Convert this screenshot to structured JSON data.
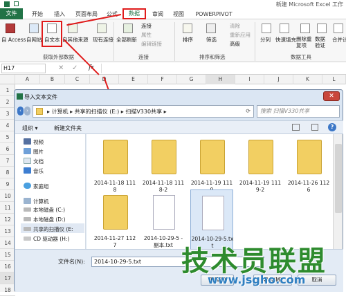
{
  "window": {
    "title": "新建 Microsoft Excel 工作"
  },
  "ribbon_tabs": [
    "文件",
    "开始",
    "插入",
    "页面布局",
    "公式",
    "数据",
    "审阅",
    "视图",
    "POWERPIVOT"
  ],
  "ribbon": {
    "from_access": "自 Access",
    "from_web": "自网站",
    "from_text": "自文本",
    "from_other": "自其他来源",
    "existing_conn": "现有连接",
    "refresh_all": "全部刷新",
    "connections": "连接",
    "properties": "属性",
    "edit_links": "编辑链接",
    "sort": "排序",
    "filter": "筛选",
    "clear": "清除",
    "reapply": "重新应用",
    "advanced": "高级",
    "text_to_columns": "分列",
    "flash_fill": "快速填充",
    "remove_dup": "删除重复项",
    "validation": "数据验证",
    "consolidate": "合并计",
    "group_external": "获取外部数据",
    "group_conn": "连接",
    "group_sort": "排序和筛选",
    "group_tools": "数据工具"
  },
  "formula_bar": {
    "name_box": "H17",
    "fx": "fx"
  },
  "columns": [
    "A",
    "B",
    "C",
    "D",
    "E",
    "F",
    "G",
    "H",
    "I",
    "J",
    "K",
    "L"
  ],
  "rows": [
    "1",
    "2",
    "3",
    "4",
    "5",
    "6",
    "7",
    "8",
    "9",
    "10",
    "11",
    "12",
    "13",
    "14",
    "15",
    "16",
    "17",
    "18"
  ],
  "dialog": {
    "title": "导入文本文件",
    "breadcrumb": [
      "计算机",
      "共享的扫描仪 (E:)",
      "扫描V330共享"
    ],
    "search_placeholder": "搜索 扫描V330共享",
    "organize": "组织 ▾",
    "new_folder": "新建文件夹",
    "nav_items": [
      {
        "label": "视频",
        "icon": "video-library-icon"
      },
      {
        "label": "图片",
        "icon": "picture-library-icon"
      },
      {
        "label": "文档",
        "icon": "document-library-icon"
      },
      {
        "label": "音乐",
        "icon": "music-library-icon"
      },
      {
        "label": "家庭组",
        "icon": "homegroup-icon"
      },
      {
        "label": "计算机",
        "icon": "computer-icon"
      },
      {
        "label": "本地磁盘 (C:)",
        "icon": "drive-icon"
      },
      {
        "label": "本地磁盘 (D:)",
        "icon": "drive-icon"
      },
      {
        "label": "共享的扫描仪 (E:",
        "icon": "drive-icon"
      },
      {
        "label": "CD 驱动器 (H:)",
        "icon": "cd-drive-icon"
      }
    ],
    "files": [
      {
        "name": "2014-11-18 1118",
        "type": "folder"
      },
      {
        "name": "2014-11-18 1118-2",
        "type": "folder"
      },
      {
        "name": "2014-11-19 1119",
        "type": "folder"
      },
      {
        "name": "2014-11-19 1119-2",
        "type": "folder"
      },
      {
        "name": "2014-11-26 1126",
        "type": "folder"
      },
      {
        "name": "2014-11-27 1127",
        "type": "folder"
      },
      {
        "name": "2014-10-29-5 - 副本.txt",
        "type": "txt"
      },
      {
        "name": "2014-10-29-5.txt",
        "type": "txt",
        "selected": true
      }
    ],
    "filename_label": "文件名(N):",
    "filename_value": "2014-10-29-5.txt",
    "tools_label": "工具(L)",
    "import_button": "导入(M)",
    "cancel_button": "取消"
  },
  "watermark": {
    "main": "技术员联盟",
    "sub": "www.jsgho.com"
  },
  "colors": {
    "excel_green": "#217346",
    "highlight_red": "#e01b1b",
    "dialog_bg": "#dbe6f3",
    "folder_yellow": "#f2cf62"
  }
}
